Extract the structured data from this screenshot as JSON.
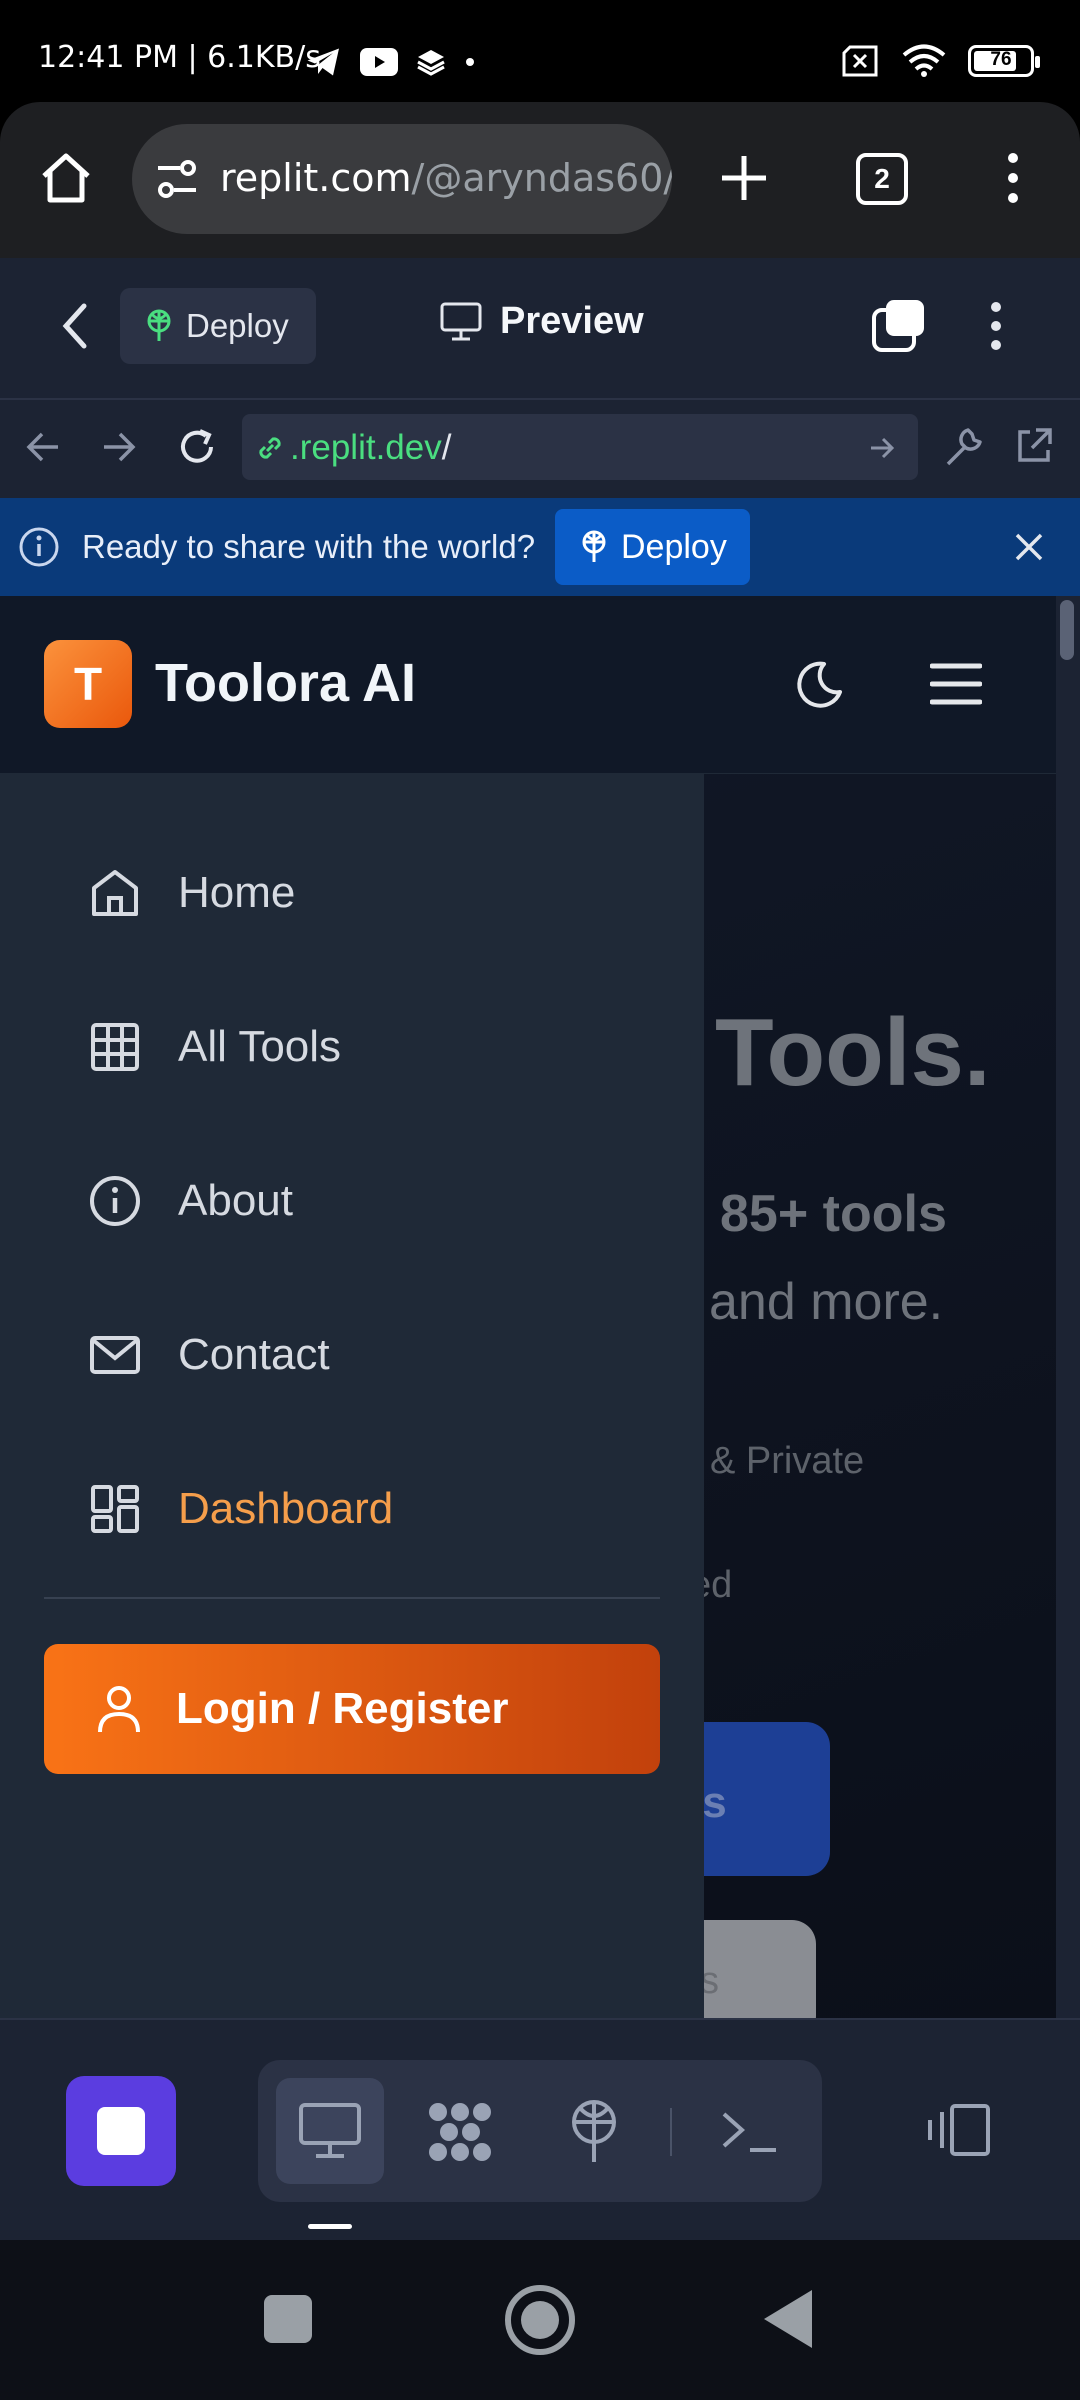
{
  "status_bar": {
    "time": "12:41 PM | 6.1KB/s",
    "battery": "76",
    "icons": [
      "telegram-icon",
      "youtube-icon",
      "stack-icon",
      "dot-icon",
      "sim-off-icon",
      "wifi-icon",
      "battery-icon"
    ]
  },
  "browser": {
    "url_host": "replit.com",
    "url_path": "/@aryndas60/",
    "tab_count": "2",
    "icons": [
      "home-icon",
      "site-settings-icon",
      "new-tab-icon",
      "tabs-icon",
      "more-icon"
    ]
  },
  "replit_header": {
    "deploy_label": "Deploy",
    "title": "Preview"
  },
  "preview_bar": {
    "url_domain": ".replit.dev",
    "url_slash": "/"
  },
  "banner": {
    "message": "Ready to share with the world?",
    "button_label": "Deploy"
  },
  "site": {
    "logo_letter": "T",
    "title": "Toolora AI"
  },
  "hero": {
    "headline_fragment": "Tools.",
    "line1_fragment": "85+ tools",
    "line2_fragment": "l and more.",
    "feature1_fragment": "& Private",
    "feature2_fragment": "ed",
    "button_fragment": "ls",
    "button2_fragment": "s"
  },
  "drawer": {
    "items": [
      {
        "label": "Home",
        "icon": "home-icon"
      },
      {
        "label": "All Tools",
        "icon": "grid-icon"
      },
      {
        "label": "About",
        "icon": "info-icon"
      },
      {
        "label": "Contact",
        "icon": "mail-icon"
      },
      {
        "label": "Dashboard",
        "icon": "dashboard-icon",
        "active": true
      }
    ],
    "login_label": "Login / Register"
  },
  "colors": {
    "accent_orange": "#f97316",
    "active_nav": "#f59e4b",
    "banner_blue": "#0a3a7a",
    "stop_purple": "#5b3de0"
  }
}
